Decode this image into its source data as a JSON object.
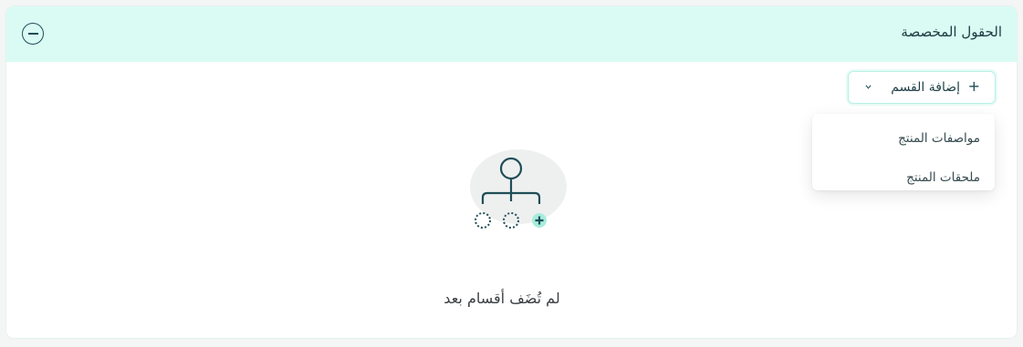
{
  "panel": {
    "title": "الحقول المخصصة"
  },
  "add_section_button": {
    "label": "إضافة القسم",
    "icon_plus": "plus-icon",
    "icon_dropdown": "chevron-down-icon"
  },
  "dropdown_menu": {
    "items": [
      {
        "label": "مواصفات المنتج"
      },
      {
        "label": "ملحقات المنتج"
      }
    ]
  },
  "empty_state": {
    "message": "لم تُضَف أقسام بعد",
    "illustration_icon": "sections-tree-icon"
  },
  "colors": {
    "header_bg": "#d9fbf4",
    "accent": "#1f4e57",
    "accent_light": "#b7f1e4",
    "illus_blob": "#eef0f0",
    "plus_badge": "#a7ecdc"
  }
}
